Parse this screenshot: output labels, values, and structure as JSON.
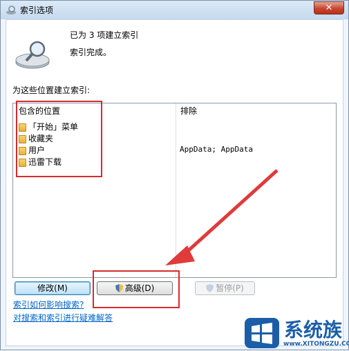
{
  "window": {
    "title": "索引选项",
    "close": "✕"
  },
  "status": {
    "count": "已为 3 项建立索引",
    "complete": "索引完成。"
  },
  "list": {
    "label": "为这些位置建立索引:",
    "col_included": "包含的位置",
    "col_excluded": "排除",
    "rows": [
      {
        "label": "「开始」菜单",
        "excluded": ""
      },
      {
        "label": "收藏夹",
        "excluded": ""
      },
      {
        "label": "用户",
        "excluded": "AppData; AppData"
      },
      {
        "label": "迅雷下载",
        "excluded": ""
      }
    ]
  },
  "buttons": {
    "modify": "修改(M)",
    "advanced": "高级(D)",
    "pause": "暂停(P)"
  },
  "links": {
    "how": "索引如何影响搜索?",
    "troubleshoot": "对搜索和索引进行疑难解答"
  },
  "watermark": {
    "brand": "系统族",
    "url": "www.XITONGZU.COM"
  },
  "colors": {
    "highlight": "#d62a2a",
    "link": "#0066cc"
  }
}
